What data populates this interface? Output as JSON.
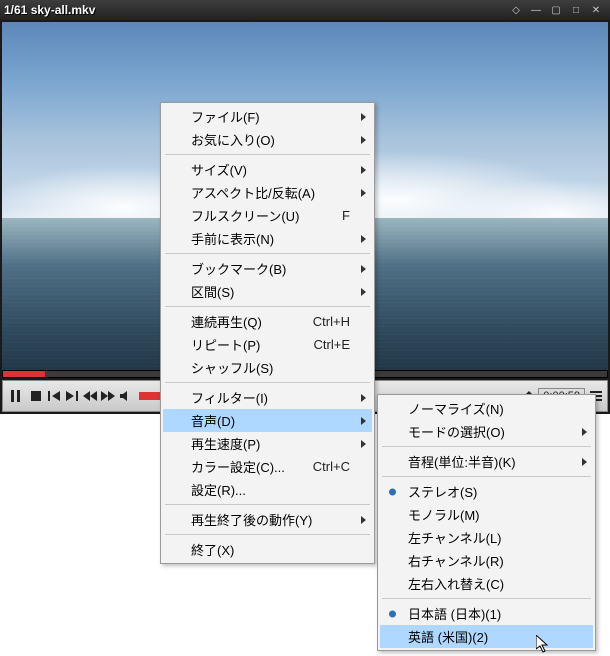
{
  "title": "1/61 sky-all.mkv",
  "time_display": "0:00:58",
  "menu1": {
    "file": "ファイル(F)",
    "favorites": "お気に入り(O)",
    "size": "サイズ(V)",
    "aspect": "アスペクト比/反転(A)",
    "fullscreen": "フルスクリーン(U)",
    "fullscreen_accel": "F",
    "ontop": "手前に表示(N)",
    "bookmark": "ブックマーク(B)",
    "section": "区間(S)",
    "repeat_play": "連続再生(Q)",
    "repeat_play_accel": "Ctrl+H",
    "repeat": "リピート(P)",
    "repeat_accel": "Ctrl+E",
    "shuffle": "シャッフル(S)",
    "filter": "フィルター(I)",
    "audio": "音声(D)",
    "speed": "再生速度(P)",
    "color": "カラー設定(C)...",
    "color_accel": "Ctrl+C",
    "settings": "設定(R)...",
    "after": "再生終了後の動作(Y)",
    "exit": "終了(X)"
  },
  "menu2": {
    "normalize": "ノーマライズ(N)",
    "mode": "モードの選択(O)",
    "pitch": "音程(単位:半音)(K)",
    "stereo": "ステレオ(S)",
    "mono": "モノラル(M)",
    "left": "左チャンネル(L)",
    "right": "右チャンネル(R)",
    "swap": "左右入れ替え(C)",
    "jp": "日本語 (日本)(1)",
    "en": "英語 (米国)(2)"
  }
}
